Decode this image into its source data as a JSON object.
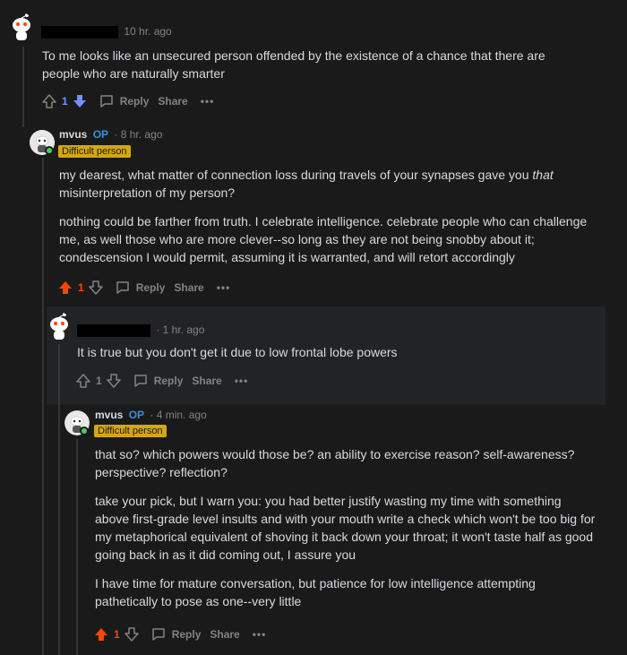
{
  "comments": [
    {
      "time": "10 hr. ago",
      "paragraphs": [
        "To me looks like an unsecured person offended by the existence of a chance that there are people who are naturally smarter"
      ],
      "votes": "1",
      "reply_label": "Reply",
      "share_label": "Share",
      "more_label": "•••"
    },
    {
      "username": "mvus",
      "op_label": "OP",
      "time": "· 8 hr. ago",
      "flair": "Difficult person",
      "p1_before": "my dearest, what matter of connection loss during travels of your synapses gave you ",
      "p1_em": "that",
      "p1_after": " misinterpretation of my person?",
      "p2": "nothing could be farther from truth. I celebrate intelligence. celebrate people who can challenge me, as well those who are more clever--so long as they are not being snobby about it; condescension I would permit, assuming it is warranted, and will retort accordingly",
      "votes": "1",
      "reply_label": "Reply",
      "share_label": "Share",
      "more_label": "•••"
    },
    {
      "time": "· 1 hr. ago",
      "paragraphs": [
        "It is true but you don't get it due to low frontal lobe powers"
      ],
      "votes": "1",
      "reply_label": "Reply",
      "share_label": "Share",
      "more_label": "•••"
    },
    {
      "username": "mvus",
      "op_label": "OP",
      "time": "· 4 min. ago",
      "flair": "Difficult person",
      "p1": "that so? which powers would those be? an ability to exercise reason? self-awareness? perspective? reflection?",
      "p2": "take your pick, but I warn you: you had better justify wasting my time with something above first-grade level insults and with your mouth write a check which won't be too big for my metaphorical equivalent of shoving it back down your throat; it won't taste half as good going back in as it did coming out, I assure you",
      "p3": "I have time for mature conversation, but patience for low intelligence attempting pathetically to pose as one--very little",
      "votes": "1",
      "reply_label": "Reply",
      "share_label": "Share",
      "more_label": "•••"
    }
  ],
  "colors": {
    "background": "#1a1a1b",
    "text": "#d7dadc",
    "meta": "#818384",
    "upvote": "#ff4500",
    "downvote": "#7193ff",
    "op": "#3a8fd9",
    "flair_bg": "#d4a70f"
  },
  "icons": [
    "snoo-avatar-icon",
    "upvote-icon",
    "downvote-icon",
    "reply-icon",
    "more-icon",
    "online-dot-icon"
  ]
}
